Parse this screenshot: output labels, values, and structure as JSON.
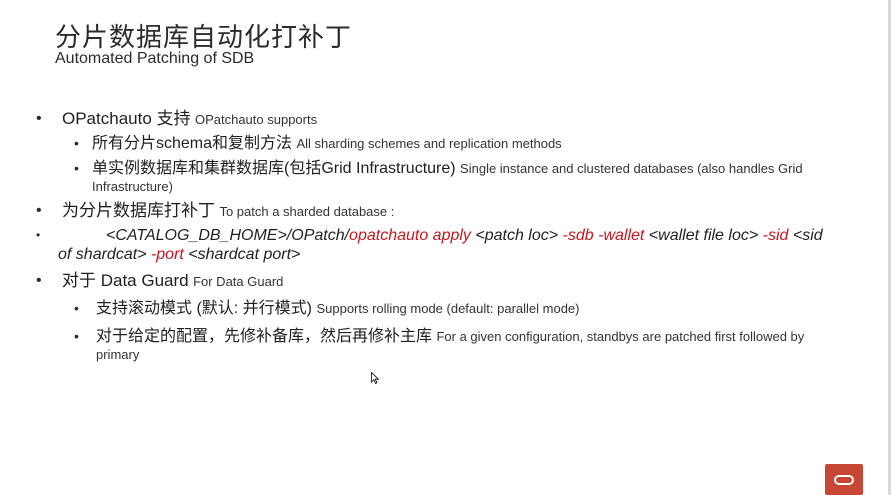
{
  "title": {
    "zh": "分片数据库自动化打补丁",
    "en": "Automated Patching of SDB"
  },
  "bullets": {
    "b1": {
      "main": "OPatchauto 支持",
      "sub": "OPatchauto supports"
    },
    "b1_1": {
      "main": "所有分片schema和复制方法",
      "sub": "All sharding schemes and replication methods"
    },
    "b1_2": {
      "main": "单实例数据库和集群数据库(包括Grid Infrastructure)",
      "sub": "Single instance and clustered databases (also handles Grid",
      "sub2": "Infrastructure)"
    },
    "b2": {
      "main": "为分片数据库打补丁",
      "sub": "To patch a sharded database :"
    },
    "cmd": {
      "t1": "<CATALOG_DB_HOME>/OPatch/",
      "t2": "opatchauto apply",
      "t3": " <patch loc> ",
      "t4": "-sdb -wallet",
      "t5": " <wallet file loc> ",
      "t6": "-sid",
      "t7": " <sid",
      "t8": "of shardcat> ",
      "t9": "-port",
      "t10": " <shardcat port>"
    },
    "b3": {
      "main": "对于 Data Guard",
      "sub": "For Data Guard"
    },
    "b3_1": {
      "main": "支持滚动模式 (默认: 并行模式)",
      "sub": "Supports rolling mode (default: parallel mode)"
    },
    "b3_2": {
      "main": "对于给定的配置，先修补备库，然后再修补主库",
      "sub": "For a given configuration, standbys are patched first followed by",
      "sub2": "primary"
    }
  },
  "bullet_glyph": "•",
  "colors": {
    "accent_red": "#c8161d",
    "brand": "#c74634"
  },
  "icons": {
    "cursor": "mouse-pointer-icon",
    "logo": "oracle-logo"
  }
}
